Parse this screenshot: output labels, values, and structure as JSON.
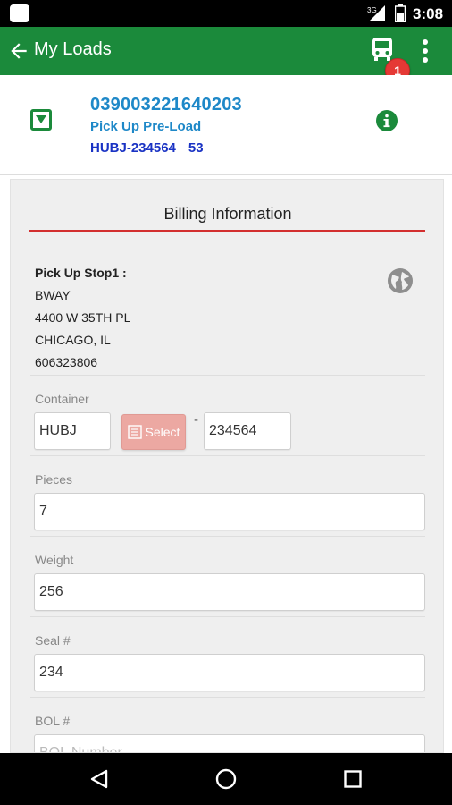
{
  "status_bar": {
    "signal_label": "3G",
    "time": "3:08"
  },
  "app_bar": {
    "title": "My Loads",
    "notification_count": "1"
  },
  "load": {
    "number": "039003221640203",
    "status": "Pick Up Pre-Load",
    "container_code": "HUBJ-234564",
    "container_suffix": "53"
  },
  "billing": {
    "title": "Billing Information",
    "stop": {
      "label": "Pick Up Stop1 :",
      "name": "BWAY",
      "address": "4400 W 35TH PL",
      "city": "CHICAGO, IL",
      "phone": "606323806"
    },
    "container": {
      "label": "Container",
      "prefix": "HUBJ",
      "select_label": "Select",
      "dash": "-",
      "number": "234564"
    },
    "pieces": {
      "label": "Pieces",
      "value": "7"
    },
    "weight": {
      "label": "Weight",
      "value": "256"
    },
    "seal": {
      "label": "Seal #",
      "value": "234"
    },
    "bol": {
      "label": "BOL #",
      "placeholder": "BOL Number"
    }
  },
  "colors": {
    "primary_green": "#1b8a3b",
    "link_blue": "#1e88c8",
    "container_blue": "#1a33c4",
    "divider_red": "#d32f2f",
    "badge_red": "#e53935"
  },
  "icons": [
    "back-arrow-icon",
    "bus-icon",
    "more-vert-icon",
    "expand-icon",
    "info-icon",
    "globe-icon",
    "list-icon",
    "nav-back-icon",
    "nav-home-icon",
    "nav-recents-icon"
  ]
}
